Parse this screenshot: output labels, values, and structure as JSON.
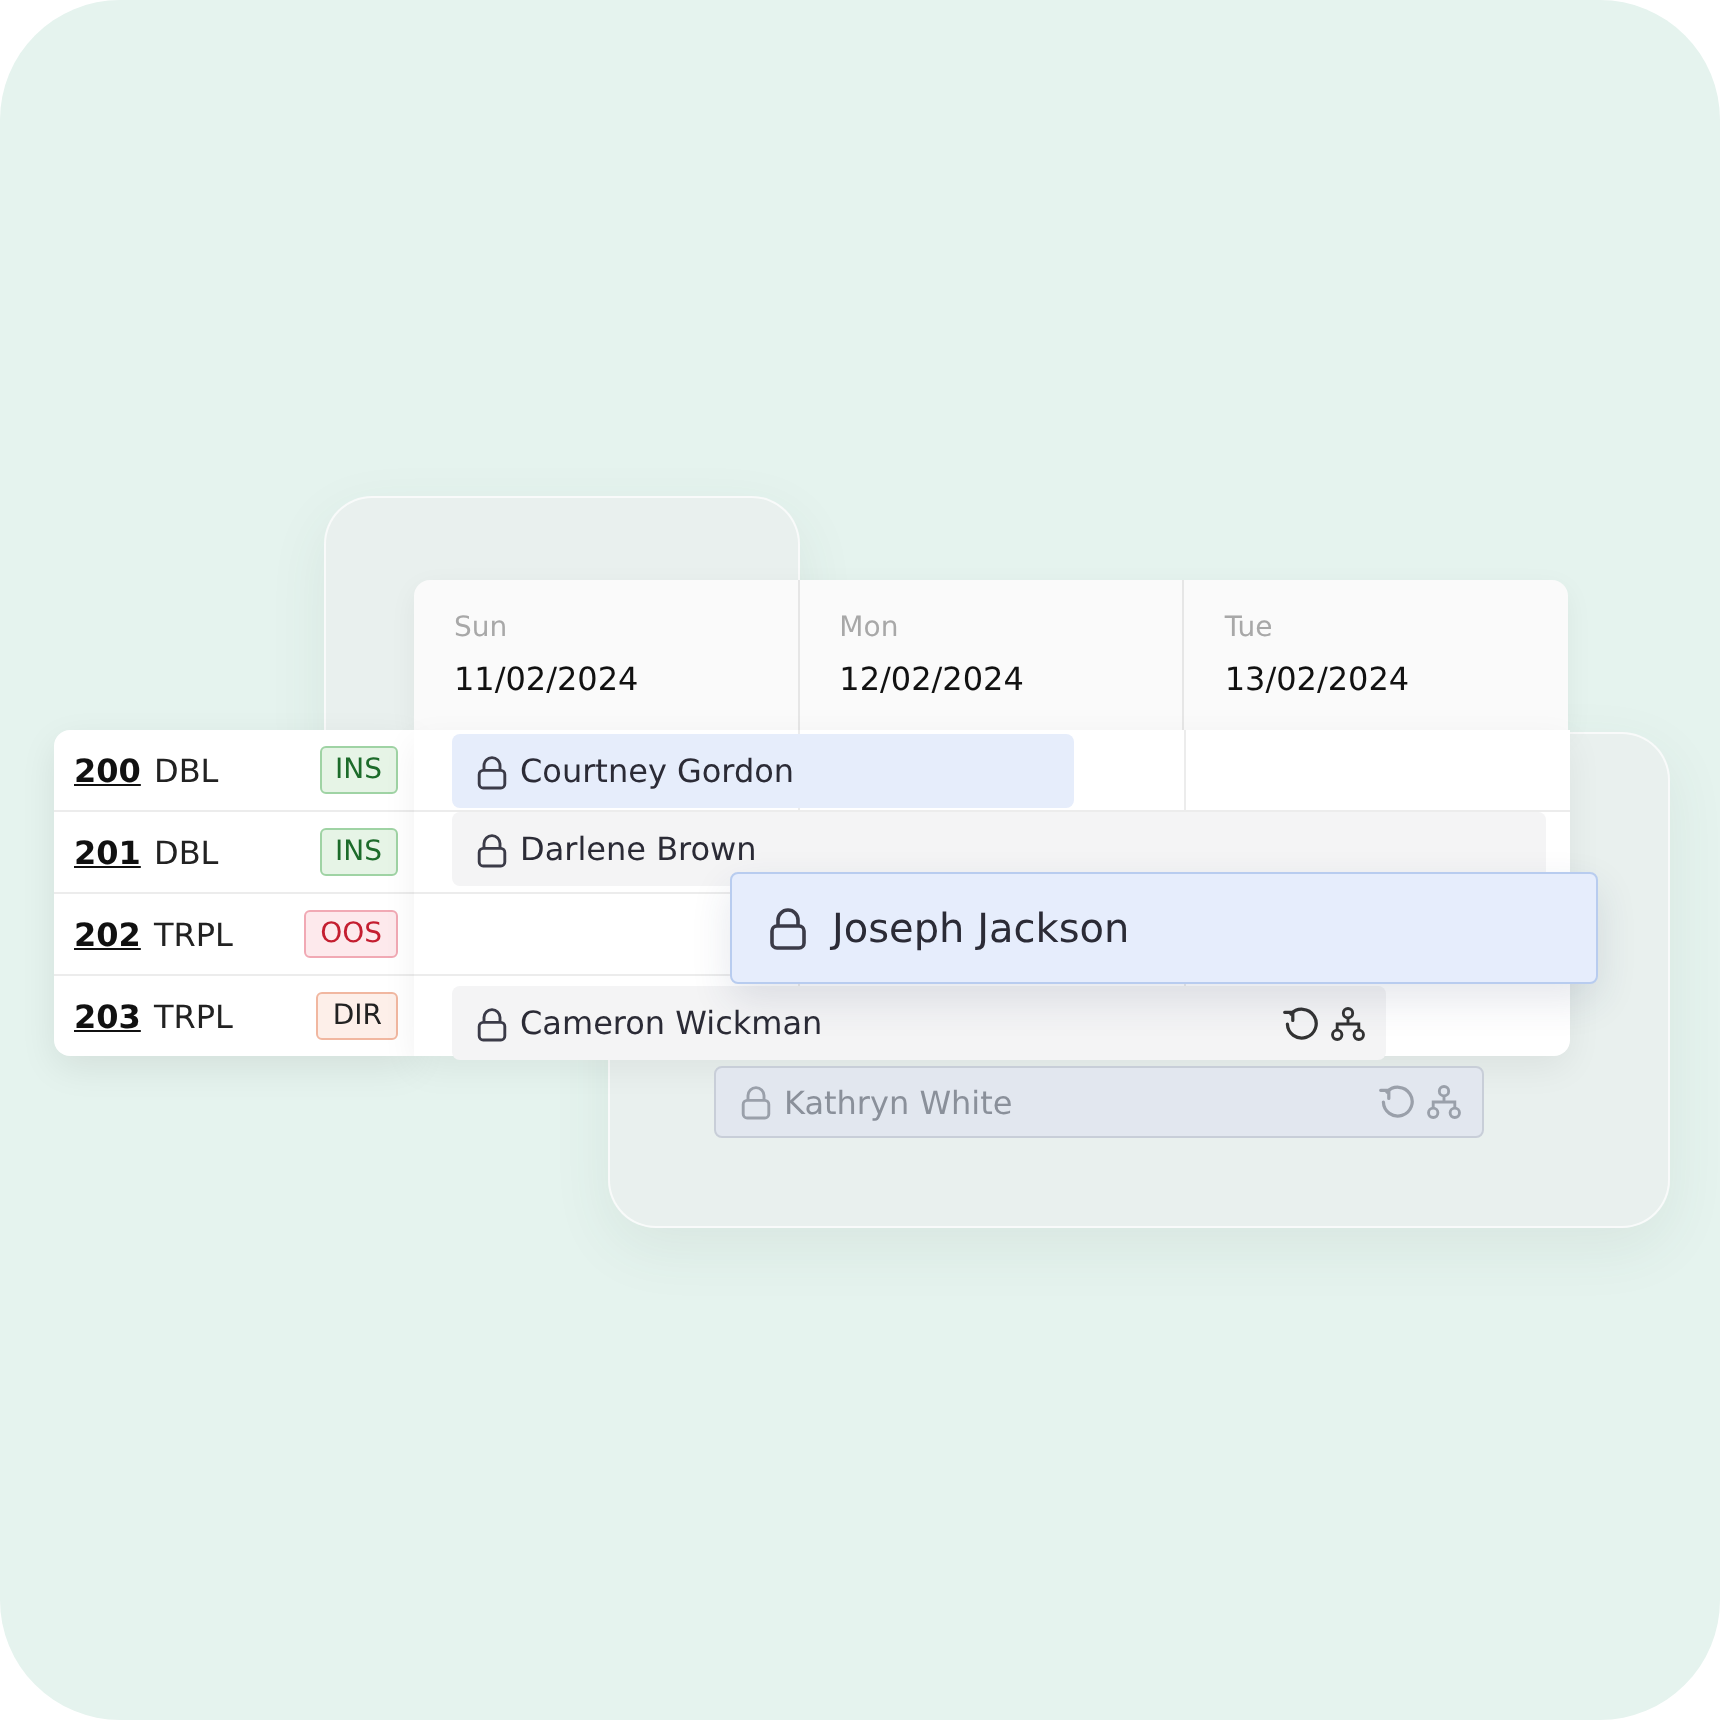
{
  "days": [
    {
      "weekday": "Sun",
      "date": "11/02/2024"
    },
    {
      "weekday": "Mon",
      "date": "12/02/2024"
    },
    {
      "weekday": "Tue",
      "date": "13/02/2024"
    }
  ],
  "rooms": [
    {
      "number": "200",
      "type": "DBL",
      "status": {
        "label": "INS",
        "kind": "inspected"
      }
    },
    {
      "number": "201",
      "type": "DBL",
      "status": {
        "label": "INS",
        "kind": "inspected"
      }
    },
    {
      "number": "202",
      "type": "TRPL",
      "status": {
        "label": "OOS",
        "kind": "out_of_service"
      }
    },
    {
      "number": "203",
      "type": "TRPL",
      "status": {
        "label": "DIR",
        "kind": "dirty"
      }
    }
  ],
  "bookings": [
    {
      "guest": "Courtney Gordon",
      "kind": "highlight",
      "recurring": false,
      "linked": false
    },
    {
      "guest": "Darlene Brown",
      "kind": "plain",
      "recurring": false,
      "linked": false
    },
    {
      "guest": "Joseph Jackson",
      "kind": "dragging",
      "recurring": false,
      "linked": false
    },
    {
      "guest": "Cameron Wickman",
      "kind": "plain",
      "recurring": true,
      "linked": true
    },
    {
      "guest": "Kathryn White",
      "kind": "ghost",
      "recurring": true,
      "linked": true
    }
  ]
}
